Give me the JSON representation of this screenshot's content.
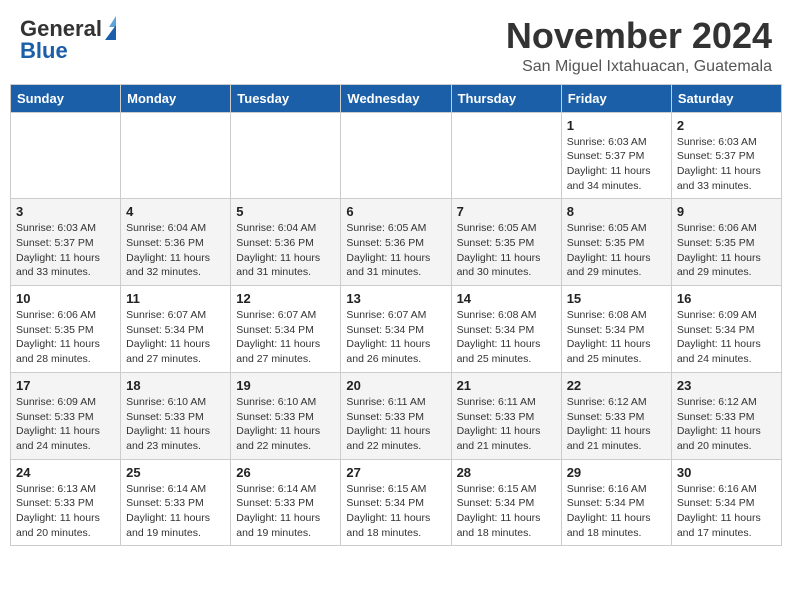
{
  "header": {
    "logo_line1": "General",
    "logo_line2": "Blue",
    "month": "November 2024",
    "location": "San Miguel Ixtahuacan, Guatemala"
  },
  "weekdays": [
    "Sunday",
    "Monday",
    "Tuesday",
    "Wednesday",
    "Thursday",
    "Friday",
    "Saturday"
  ],
  "weeks": [
    [
      {
        "day": "",
        "info": ""
      },
      {
        "day": "",
        "info": ""
      },
      {
        "day": "",
        "info": ""
      },
      {
        "day": "",
        "info": ""
      },
      {
        "day": "",
        "info": ""
      },
      {
        "day": "1",
        "info": "Sunrise: 6:03 AM\nSunset: 5:37 PM\nDaylight: 11 hours and 34 minutes."
      },
      {
        "day": "2",
        "info": "Sunrise: 6:03 AM\nSunset: 5:37 PM\nDaylight: 11 hours and 33 minutes."
      }
    ],
    [
      {
        "day": "3",
        "info": "Sunrise: 6:03 AM\nSunset: 5:37 PM\nDaylight: 11 hours and 33 minutes."
      },
      {
        "day": "4",
        "info": "Sunrise: 6:04 AM\nSunset: 5:36 PM\nDaylight: 11 hours and 32 minutes."
      },
      {
        "day": "5",
        "info": "Sunrise: 6:04 AM\nSunset: 5:36 PM\nDaylight: 11 hours and 31 minutes."
      },
      {
        "day": "6",
        "info": "Sunrise: 6:05 AM\nSunset: 5:36 PM\nDaylight: 11 hours and 31 minutes."
      },
      {
        "day": "7",
        "info": "Sunrise: 6:05 AM\nSunset: 5:35 PM\nDaylight: 11 hours and 30 minutes."
      },
      {
        "day": "8",
        "info": "Sunrise: 6:05 AM\nSunset: 5:35 PM\nDaylight: 11 hours and 29 minutes."
      },
      {
        "day": "9",
        "info": "Sunrise: 6:06 AM\nSunset: 5:35 PM\nDaylight: 11 hours and 29 minutes."
      }
    ],
    [
      {
        "day": "10",
        "info": "Sunrise: 6:06 AM\nSunset: 5:35 PM\nDaylight: 11 hours and 28 minutes."
      },
      {
        "day": "11",
        "info": "Sunrise: 6:07 AM\nSunset: 5:34 PM\nDaylight: 11 hours and 27 minutes."
      },
      {
        "day": "12",
        "info": "Sunrise: 6:07 AM\nSunset: 5:34 PM\nDaylight: 11 hours and 27 minutes."
      },
      {
        "day": "13",
        "info": "Sunrise: 6:07 AM\nSunset: 5:34 PM\nDaylight: 11 hours and 26 minutes."
      },
      {
        "day": "14",
        "info": "Sunrise: 6:08 AM\nSunset: 5:34 PM\nDaylight: 11 hours and 25 minutes."
      },
      {
        "day": "15",
        "info": "Sunrise: 6:08 AM\nSunset: 5:34 PM\nDaylight: 11 hours and 25 minutes."
      },
      {
        "day": "16",
        "info": "Sunrise: 6:09 AM\nSunset: 5:34 PM\nDaylight: 11 hours and 24 minutes."
      }
    ],
    [
      {
        "day": "17",
        "info": "Sunrise: 6:09 AM\nSunset: 5:33 PM\nDaylight: 11 hours and 24 minutes."
      },
      {
        "day": "18",
        "info": "Sunrise: 6:10 AM\nSunset: 5:33 PM\nDaylight: 11 hours and 23 minutes."
      },
      {
        "day": "19",
        "info": "Sunrise: 6:10 AM\nSunset: 5:33 PM\nDaylight: 11 hours and 22 minutes."
      },
      {
        "day": "20",
        "info": "Sunrise: 6:11 AM\nSunset: 5:33 PM\nDaylight: 11 hours and 22 minutes."
      },
      {
        "day": "21",
        "info": "Sunrise: 6:11 AM\nSunset: 5:33 PM\nDaylight: 11 hours and 21 minutes."
      },
      {
        "day": "22",
        "info": "Sunrise: 6:12 AM\nSunset: 5:33 PM\nDaylight: 11 hours and 21 minutes."
      },
      {
        "day": "23",
        "info": "Sunrise: 6:12 AM\nSunset: 5:33 PM\nDaylight: 11 hours and 20 minutes."
      }
    ],
    [
      {
        "day": "24",
        "info": "Sunrise: 6:13 AM\nSunset: 5:33 PM\nDaylight: 11 hours and 20 minutes."
      },
      {
        "day": "25",
        "info": "Sunrise: 6:14 AM\nSunset: 5:33 PM\nDaylight: 11 hours and 19 minutes."
      },
      {
        "day": "26",
        "info": "Sunrise: 6:14 AM\nSunset: 5:33 PM\nDaylight: 11 hours and 19 minutes."
      },
      {
        "day": "27",
        "info": "Sunrise: 6:15 AM\nSunset: 5:34 PM\nDaylight: 11 hours and 18 minutes."
      },
      {
        "day": "28",
        "info": "Sunrise: 6:15 AM\nSunset: 5:34 PM\nDaylight: 11 hours and 18 minutes."
      },
      {
        "day": "29",
        "info": "Sunrise: 6:16 AM\nSunset: 5:34 PM\nDaylight: 11 hours and 18 minutes."
      },
      {
        "day": "30",
        "info": "Sunrise: 6:16 AM\nSunset: 5:34 PM\nDaylight: 11 hours and 17 minutes."
      }
    ]
  ]
}
